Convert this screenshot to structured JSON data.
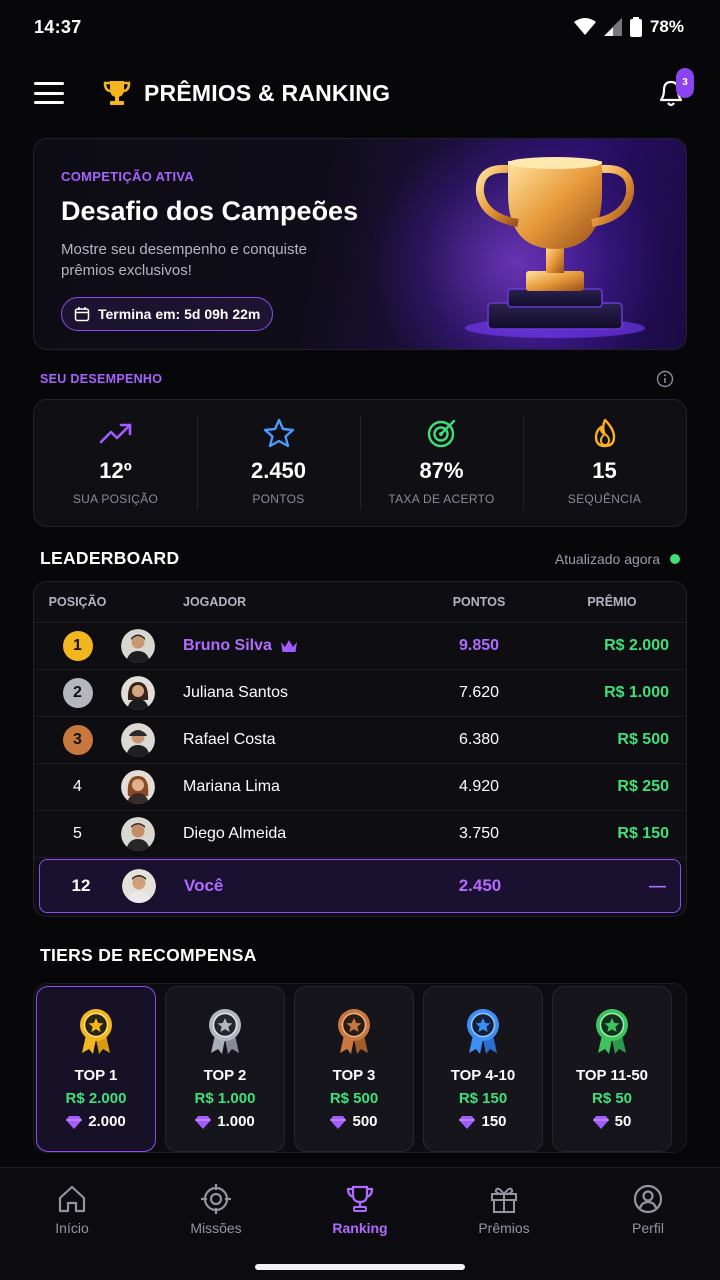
{
  "status_bar": {
    "time": "14:37",
    "battery": "78%"
  },
  "header": {
    "title": "PRÊMIOS & RANKING",
    "notification_badge": "3"
  },
  "hero": {
    "label": "COMPETIÇÃO ATIVA",
    "title": "Desafio dos Campeões",
    "description": "Mostre seu desempenho e conquiste prêmios exclusivos!",
    "timer": "Termina em: 5d 09h 22m"
  },
  "performance": {
    "heading": "SEU DESEMPENHO",
    "stats": [
      {
        "icon": "trend-up-icon",
        "value": "12º",
        "label": "SUA POSIÇÃO",
        "color": "#a35cff"
      },
      {
        "icon": "star-icon",
        "value": "2.450",
        "label": "PONTOS",
        "color": "#4a9bff"
      },
      {
        "icon": "target-icon",
        "value": "87%",
        "label": "TAXA DE ACERTO",
        "color": "#3ee07a"
      },
      {
        "icon": "flame-icon",
        "value": "15",
        "label": "SEQUÊNCIA",
        "color": "#ffb020"
      }
    ]
  },
  "leaderboard": {
    "heading": "LEADERBOARD",
    "updated": "Atualizado agora",
    "columns": {
      "position": "POSIÇÃO",
      "player": "JOGADOR",
      "points": "PONTOS",
      "prize": "PRÊMIO"
    },
    "rows": [
      {
        "pos": "1",
        "name": "Bruno Silva",
        "points": "9.850",
        "prize": "R$ 2.000"
      },
      {
        "pos": "2",
        "name": "Juliana Santos",
        "points": "7.620",
        "prize": "R$ 1.000"
      },
      {
        "pos": "3",
        "name": "Rafael Costa",
        "points": "6.380",
        "prize": "R$ 500"
      },
      {
        "pos": "4",
        "name": "Mariana Lima",
        "points": "4.920",
        "prize": "R$ 250"
      },
      {
        "pos": "5",
        "name": "Diego Almeida",
        "points": "3.750",
        "prize": "R$ 150"
      }
    ],
    "you": {
      "pos": "12",
      "name": "Você",
      "points": "2.450",
      "prize": "—"
    }
  },
  "tiers": {
    "heading": "TIERS DE RECOMPENSA",
    "items": [
      {
        "label": "TOP 1",
        "prize": "R$ 2.000",
        "gems": "2.000",
        "color": "#f2b71e"
      },
      {
        "label": "TOP 2",
        "prize": "R$ 1.000",
        "gems": "1.000",
        "color": "#a9adb8"
      },
      {
        "label": "TOP 3",
        "prize": "R$ 500",
        "gems": "500",
        "color": "#c8773f"
      },
      {
        "label": "TOP 4-10",
        "prize": "R$ 150",
        "gems": "150",
        "color": "#3d8ef5"
      },
      {
        "label": "TOP 11-50",
        "prize": "R$ 50",
        "gems": "50",
        "color": "#3ec45f"
      }
    ]
  },
  "nav": {
    "items": [
      {
        "label": "Início"
      },
      {
        "label": "Missões"
      },
      {
        "label": "Ranking"
      },
      {
        "label": "Prêmios"
      },
      {
        "label": "Perfil"
      }
    ]
  }
}
